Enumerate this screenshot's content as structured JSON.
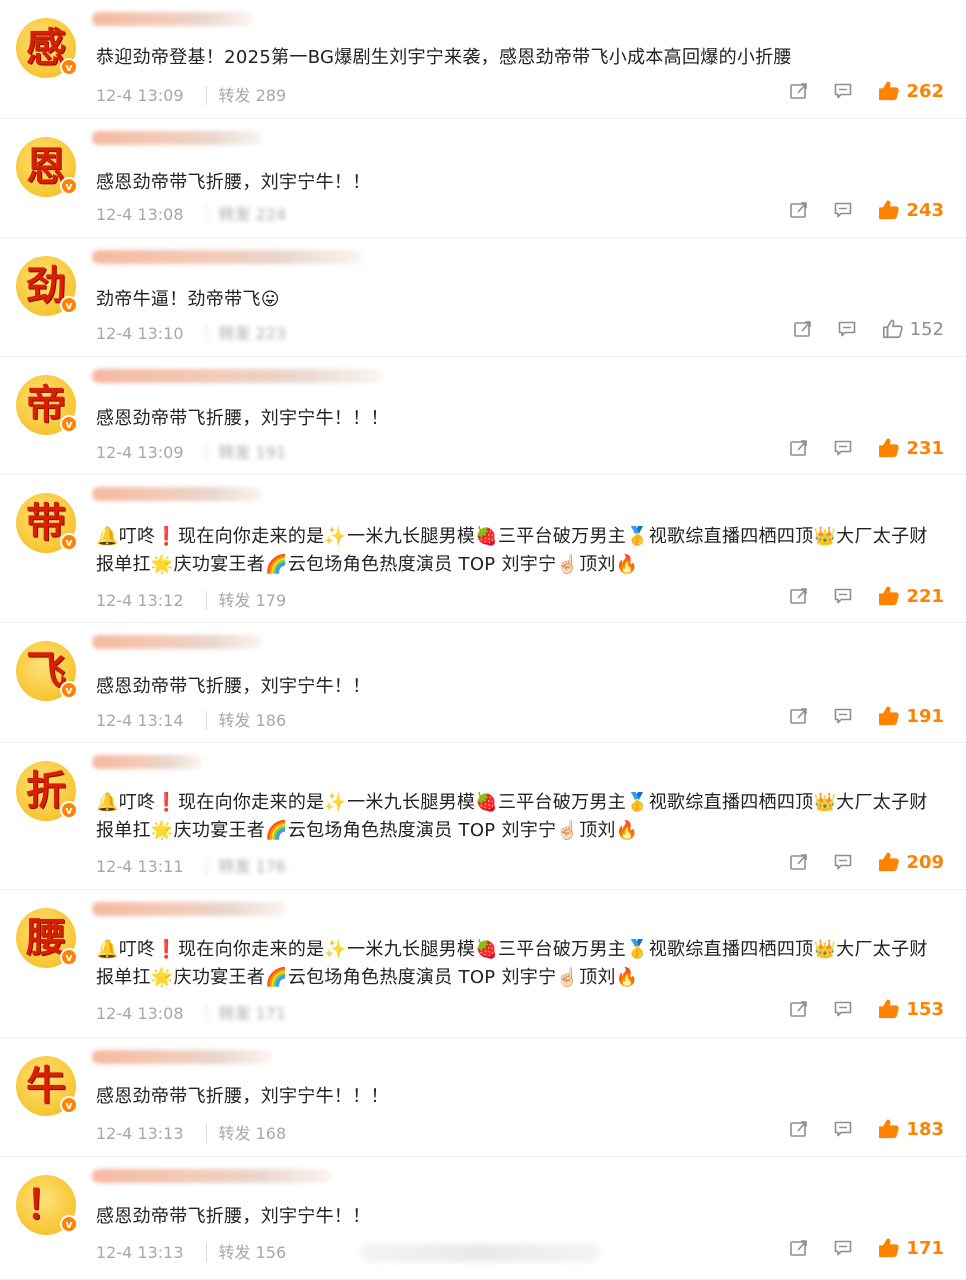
{
  "comments": [
    {
      "avatar_char": "感",
      "text": "恭迎劲帝登基！2025第一BG爆剧生刘宇宁来袭，感恩劲帝带飞小成本高回爆的小折腰",
      "time": "12-4 13:09",
      "repost": "转发 289",
      "likes": "262",
      "liked": true
    },
    {
      "avatar_char": "恩",
      "text": "感恩劲帝带飞折腰，刘宇宁牛！！",
      "time": "12-4 13:08",
      "repost": "转发 224",
      "likes": "243",
      "liked": true
    },
    {
      "avatar_char": "劲",
      "text": "劲帝牛逼！劲帝带飞😛",
      "time": "12-4 13:10",
      "repost": "转发 223",
      "likes": "152",
      "liked": false
    },
    {
      "avatar_char": "帝",
      "text": "感恩劲帝带飞折腰，刘宇宁牛！！！",
      "time": "12-4 13:09",
      "repost": "转发 191",
      "likes": "231",
      "liked": true
    },
    {
      "avatar_char": "带",
      "text": "🔔叮咚❗现在向你走来的是✨一米九长腿男模🍓三平台破万男主🥇视歌综直播四栖四顶👑大厂太子财报单扛🌟庆功宴王者🌈云包场角色热度演员 TOP 刘宇宁☝🏻顶刘🔥",
      "time": "12-4 13:12",
      "repost": "转发 179",
      "likes": "221",
      "liked": true
    },
    {
      "avatar_char": "飞",
      "text": "感恩劲帝带飞折腰，刘宇宁牛！！",
      "time": "12-4 13:14",
      "repost": "转发 186",
      "likes": "191",
      "liked": true
    },
    {
      "avatar_char": "折",
      "text": "🔔叮咚❗现在向你走来的是✨一米九长腿男模🍓三平台破万男主🥇视歌综直播四栖四顶👑大厂太子财报单扛🌟庆功宴王者🌈云包场角色热度演员 TOP 刘宇宁☝🏻顶刘🔥",
      "time": "12-4 13:11",
      "repost": "转发 176",
      "likes": "209",
      "liked": true
    },
    {
      "avatar_char": "腰",
      "text": "🔔叮咚❗现在向你走来的是✨一米九长腿男模🍓三平台破万男主🥇视歌综直播四栖四顶👑大厂太子财报单扛🌟庆功宴王者🌈云包场角色热度演员 TOP 刘宇宁☝🏻顶刘🔥",
      "time": "12-4 13:08",
      "repost": "转发 171",
      "likes": "153",
      "liked": true
    },
    {
      "avatar_char": "牛",
      "text": "感恩劲帝带飞折腰，刘宇宁牛！！！",
      "time": "12-4 13:13",
      "repost": "转发 168",
      "likes": "183",
      "liked": true
    },
    {
      "avatar_char": "！",
      "text": "感恩劲帝带飞折腰，刘宇宁牛！！",
      "time": "12-4 13:13",
      "repost": "转发 156",
      "likes": "171",
      "liked": true
    }
  ],
  "colors": {
    "accent": "#ff8200",
    "avatar_char": "#d81e06",
    "meta": "#a8a8a8"
  },
  "icons": {
    "share": "share-icon",
    "comment": "comment-icon",
    "like": "thumbs-up-icon",
    "verified": "verified-badge-icon"
  }
}
